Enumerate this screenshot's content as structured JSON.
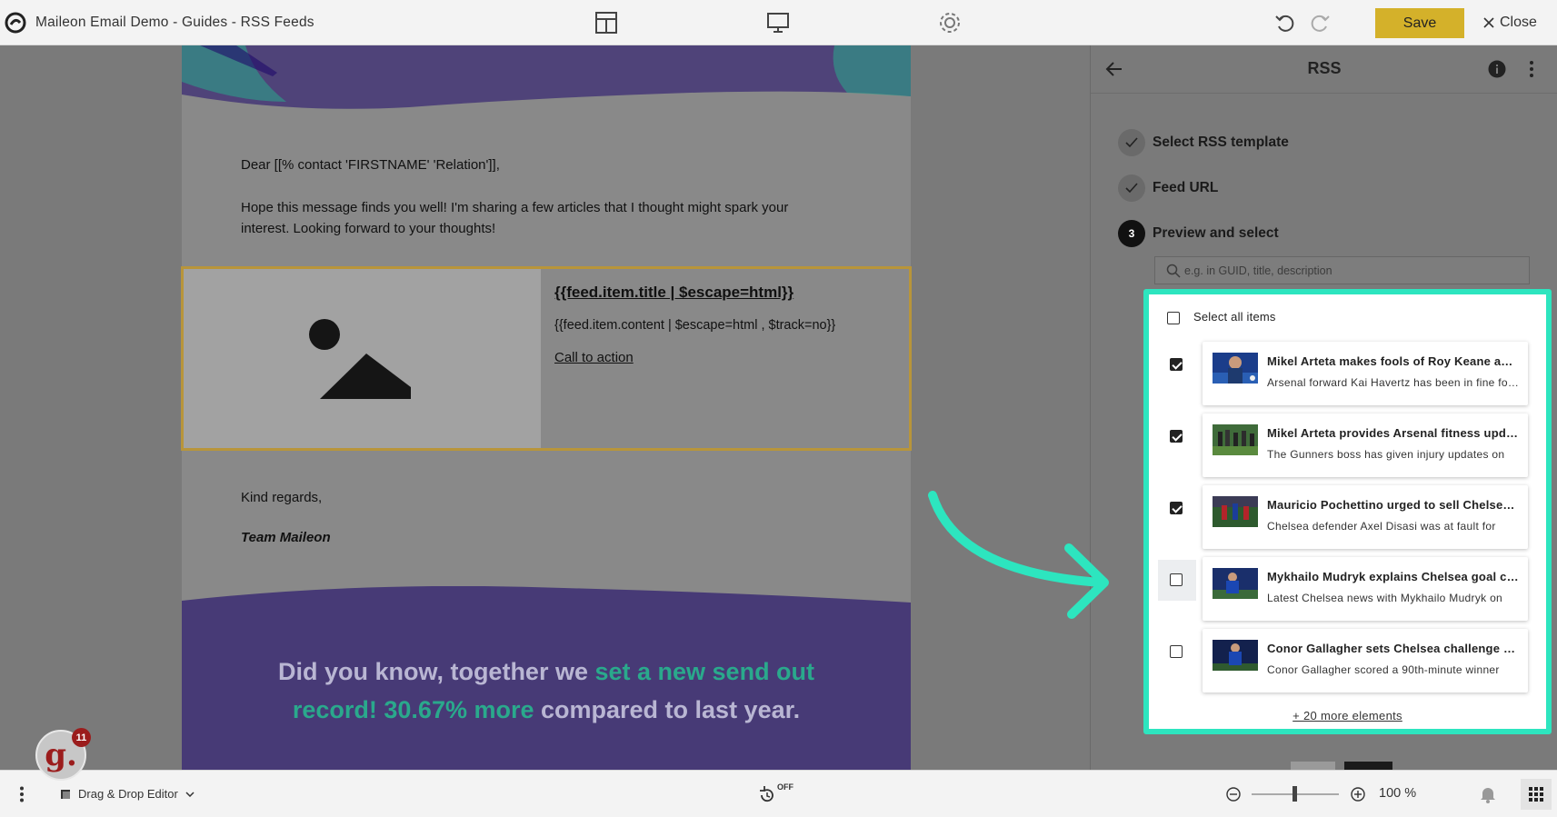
{
  "window": {
    "title": "Maileon Email Demo - Guides - RSS Feeds"
  },
  "toolbar": {
    "save_label": "Save",
    "close_label": "Close"
  },
  "email": {
    "greeting": "Dear [[% contact 'FIRSTNAME' 'Relation']],",
    "intro_line1": "Hope this message finds you well! I'm sharing a few articles that I thought might spark your",
    "intro_line2": "interest. Looking forward to your thoughts!",
    "rss_title": "{{feed.item.title | $escape=html}}",
    "rss_content": "{{feed.item.content | $escape=html , $track=no}}",
    "rss_cta": "Call to action",
    "closing": "Kind regards,",
    "signature": "Team Maileon",
    "banner": {
      "part1": "Did you know, together we ",
      "highlight1": "set a new send out",
      "highlight2": "record! 30.67% more",
      "part2": " compared to last year."
    }
  },
  "panel": {
    "title": "RSS",
    "steps": [
      {
        "number": "",
        "label": "Select RSS template",
        "state": "done"
      },
      {
        "number": "",
        "label": "Feed URL",
        "state": "done"
      },
      {
        "number": "3",
        "label": "Preview and select",
        "state": "active"
      }
    ],
    "search": {
      "placeholder": "e.g. in GUID, title, description",
      "value": ""
    },
    "select_all_label": "Select all items",
    "select_all_checked": false,
    "items": [
      {
        "title": "Mikel Arteta makes fools of Roy Keane and Gary Neville",
        "desc": "Arsenal forward Kai Havertz has been in fine form",
        "checked": true
      },
      {
        "title": "Mikel Arteta provides Arsenal fitness update",
        "desc": "The Gunners boss has given injury updates on",
        "checked": true
      },
      {
        "title": "Mauricio Pochettino urged to sell Chelsea defender",
        "desc": "Chelsea defender Axel Disasi was at fault for",
        "checked": true
      },
      {
        "title": "Mykhailo Mudryk explains Chelsea goal celebration",
        "desc": "Latest Chelsea news with Mykhailo Mudryk on",
        "checked": false
      },
      {
        "title": "Conor Gallagher sets Chelsea challenge after win",
        "desc": "Conor Gallagher scored a 90th-minute winner",
        "checked": false
      }
    ],
    "more_label": "+ 20 more elements"
  },
  "bottom": {
    "editor_mode": "Drag & Drop Editor",
    "autosave_state": "OFF",
    "zoom": "100 %",
    "zoom_level": 0.5
  },
  "badge": {
    "letter": "g.",
    "count": "11"
  },
  "colors": {
    "accent_save": "#d4b12a",
    "highlight_frame": "#2de5bf",
    "banner_bg": "#1f0a6b",
    "banner_highlight": "#2aa98c",
    "rss_block_border": "#b8953a"
  }
}
